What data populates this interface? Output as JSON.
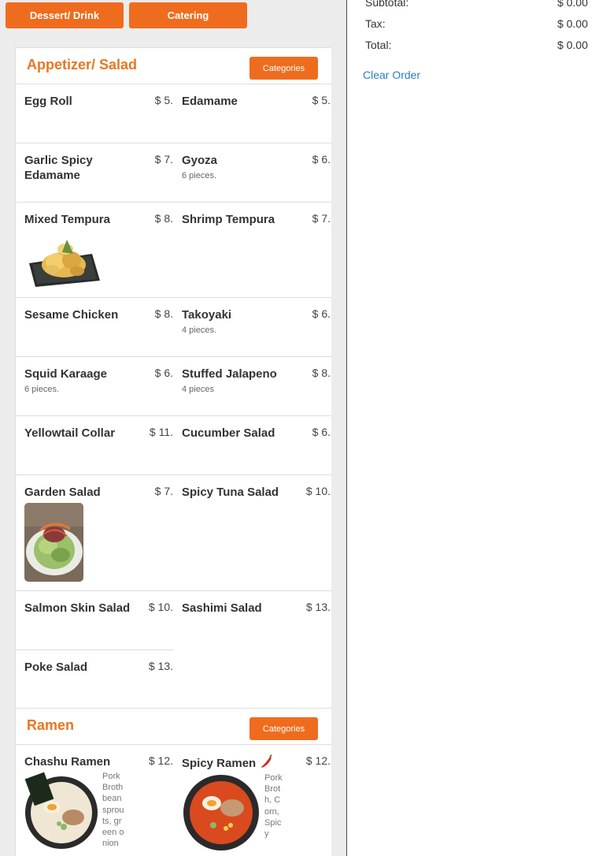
{
  "topnav": {
    "dessert_label": "Dessert/ Drink",
    "catering_label": "Catering"
  },
  "sections": {
    "appetizer": {
      "title": "Appetizer/ Salad",
      "categories_label": "Categories",
      "items": [
        {
          "name": "Egg Roll",
          "price": "$ 5.",
          "desc": ""
        },
        {
          "name": "Edamame",
          "price": "$ 5.",
          "desc": ""
        },
        {
          "name": "Garlic Spicy Edamame",
          "price": "$ 7.",
          "desc": ""
        },
        {
          "name": "Gyoza",
          "price": "$ 6.",
          "desc": "6 pieces."
        },
        {
          "name": "Mixed Tempura",
          "price": "$ 8.",
          "desc": ""
        },
        {
          "name": "Shrimp Tempura",
          "price": "$ 7.",
          "desc": ""
        },
        {
          "name": "Sesame Chicken",
          "price": "$ 8.",
          "desc": ""
        },
        {
          "name": "Takoyaki",
          "price": "$ 6.",
          "desc": "4 pieces."
        },
        {
          "name": "Squid Karaage",
          "price": "$ 6.",
          "desc": "6 pieces."
        },
        {
          "name": "Stuffed Jalapeno",
          "price": "$ 8.",
          "desc": "4 pieces"
        },
        {
          "name": "Yellowtail Collar",
          "price": "$ 11.",
          "desc": ""
        },
        {
          "name": "Cucumber Salad",
          "price": "$ 6.",
          "desc": ""
        },
        {
          "name": "Garden Salad",
          "price": "$ 7.",
          "desc": ""
        },
        {
          "name": "Spicy Tuna Salad",
          "price": "$ 10.",
          "desc": ""
        },
        {
          "name": "Salmon Skin Salad",
          "price": "$ 10.",
          "desc": ""
        },
        {
          "name": "Sashimi Salad",
          "price": "$ 13.",
          "desc": ""
        },
        {
          "name": "Poke Salad",
          "price": "$ 13.",
          "desc": ""
        }
      ]
    },
    "ramen": {
      "title": "Ramen",
      "categories_label": "Categories",
      "items": [
        {
          "name": "Chashu Ramen",
          "price": "$ 12.",
          "desc": "Pork Broth bean sprouts, green onion"
        },
        {
          "name": "Spicy Ramen",
          "price": "$ 12.",
          "desc": "Pork Broth, Corn, Spicy"
        }
      ]
    }
  },
  "order": {
    "subtotal_label": "Subtotal:",
    "subtotal_value": "$ 0.00",
    "tax_label": "Tax:",
    "tax_value": "$ 0.00",
    "total_label": "Total:",
    "total_value": "$ 0.00",
    "clear_label": "Clear Order"
  },
  "colors": {
    "accent": "#ef6c1e",
    "title": "#e87722",
    "link": "#2a7fc0"
  },
  "icons": {
    "spicy": "chili-pepper-icon"
  }
}
